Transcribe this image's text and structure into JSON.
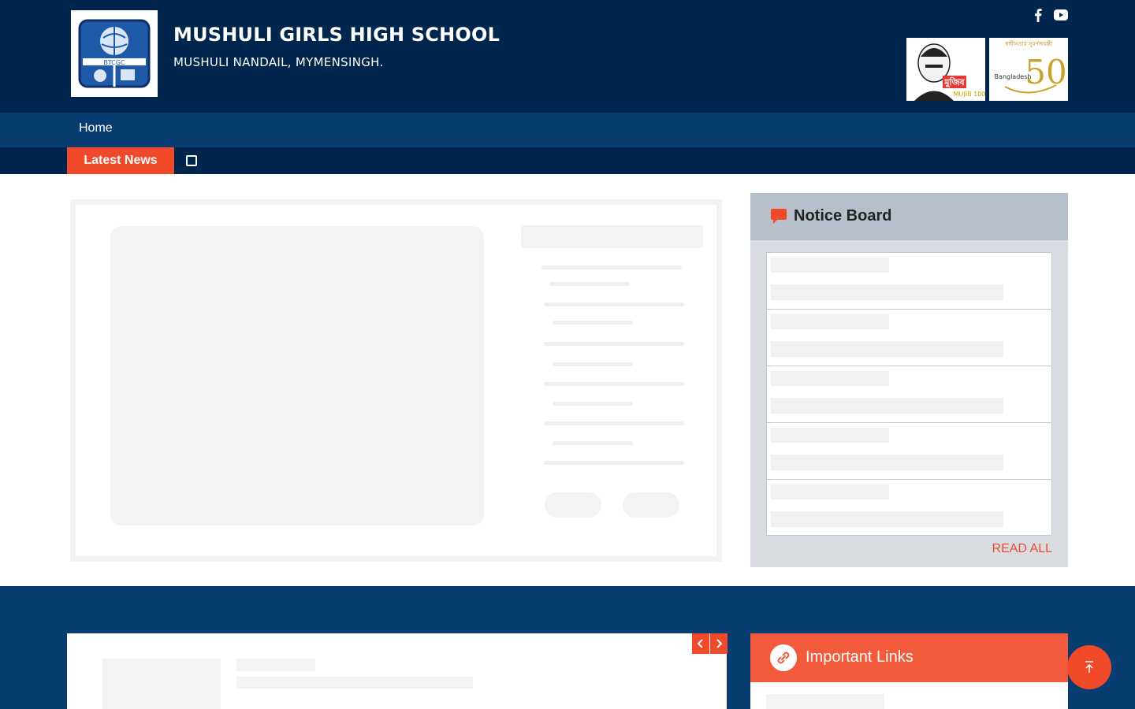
{
  "header": {
    "school_name": "MUSHULI GIRLS HIGH SCHOOL",
    "address": "MUSHULI NANDAIL, MYMENSINGH.",
    "logo_text": "BTCGC",
    "social": [
      {
        "icon": "facebook-icon"
      },
      {
        "icon": "youtube-icon"
      }
    ],
    "emblems": [
      {
        "icon": "mujib-100-emblem",
        "text": "মুজিব",
        "sub": "MUJIB 100"
      },
      {
        "icon": "bangladesh-50-emblem",
        "text": "Bangladesh",
        "num": "50"
      }
    ]
  },
  "nav": {
    "items": [
      {
        "label": "Home"
      }
    ]
  },
  "ticker": {
    "label": "Latest News"
  },
  "notice_board": {
    "title": "Notice Board",
    "read_all": "READ ALL",
    "row_count": 5
  },
  "important_links": {
    "title": "Important Links"
  },
  "colors": {
    "navy": "#00264d",
    "nav_blue": "#073d70",
    "accent": "#f04a2b",
    "notice_bg": "#d9dde2"
  }
}
